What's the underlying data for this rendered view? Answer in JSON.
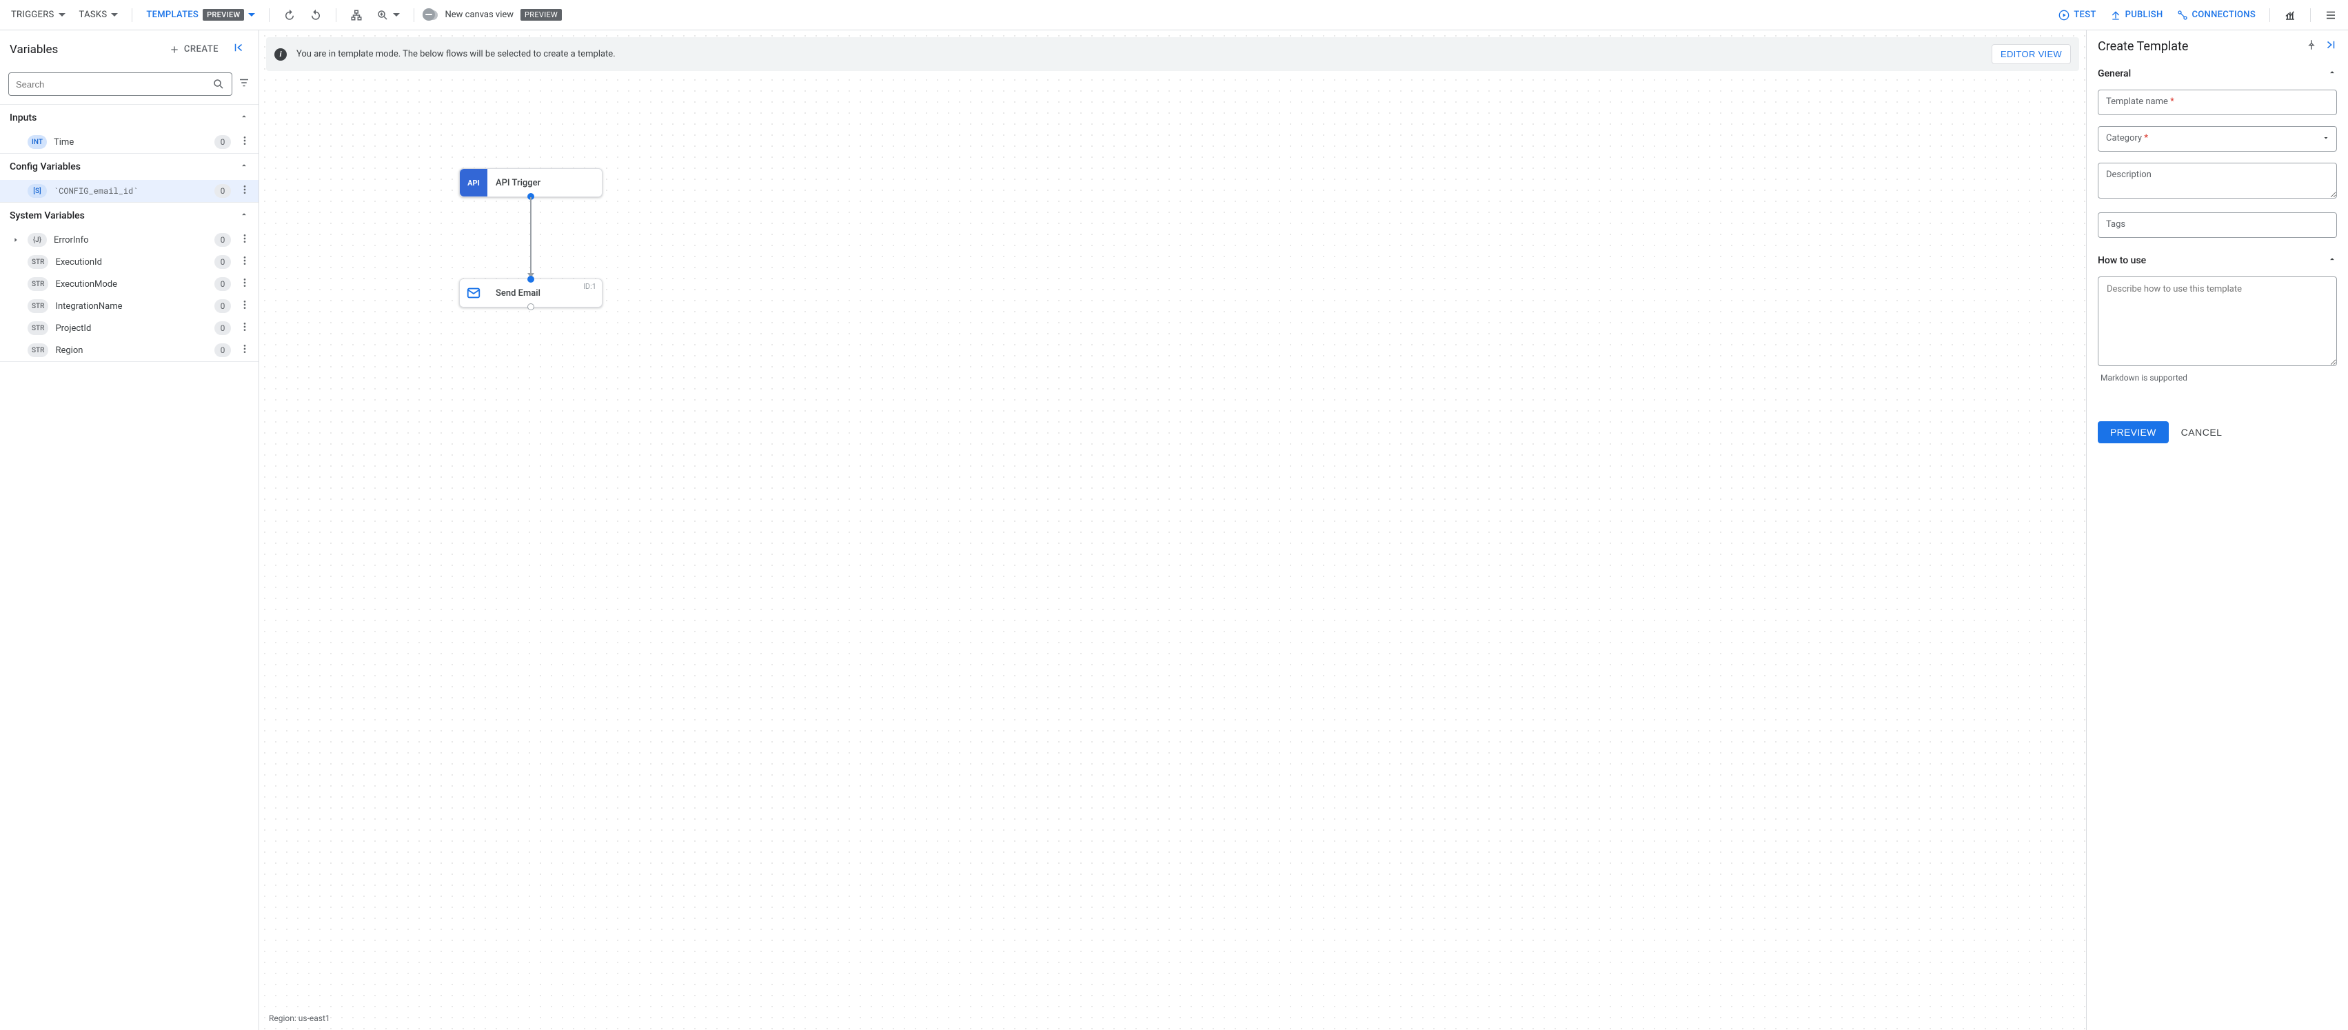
{
  "toolbar": {
    "triggers": "TRIGGERS",
    "tasks": "TASKS",
    "templates": "TEMPLATES",
    "preview_badge": "PREVIEW",
    "new_canvas": "New canvas view",
    "preview_badge2": "PREVIEW",
    "test": "TEST",
    "publish": "PUBLISH",
    "connections": "CONNECTIONS"
  },
  "sidebar": {
    "title": "Variables",
    "create": "CREATE",
    "search_placeholder": "Search",
    "sections": {
      "inputs": "Inputs",
      "config": "Config Variables",
      "system": "System Variables"
    },
    "inputs": [
      {
        "type": "INT",
        "name": "Time",
        "count": "0"
      }
    ],
    "config": [
      {
        "type": "[S]",
        "name": "`CONFIG_email_id`",
        "count": "0"
      }
    ],
    "system": [
      {
        "type": "{J}",
        "name": "ErrorInfo",
        "count": "0",
        "caret": true
      },
      {
        "type": "STR",
        "name": "ExecutionId",
        "count": "0"
      },
      {
        "type": "STR",
        "name": "ExecutionMode",
        "count": "0"
      },
      {
        "type": "STR",
        "name": "IntegrationName",
        "count": "0"
      },
      {
        "type": "STR",
        "name": "ProjectId",
        "count": "0"
      },
      {
        "type": "STR",
        "name": "Region",
        "count": "0"
      }
    ]
  },
  "canvas": {
    "info_text": "You are in template mode. The below flows will be selected to create a template.",
    "editor_view": "EDITOR VIEW",
    "node_api": "API Trigger",
    "node_email": "Send Email",
    "node_email_id": "ID:1",
    "region": "Region: us-east1"
  },
  "rpanel": {
    "title": "Create Template",
    "general_heading": "General",
    "template_name_label": "Template name",
    "category_label": "Category",
    "description_label": "Description",
    "tags_label": "Tags",
    "howto_heading": "How to use",
    "howto_placeholder": "Describe how to use this template",
    "howto_helper": "Markdown is supported",
    "preview_btn": "PREVIEW",
    "cancel_btn": "CANCEL"
  }
}
